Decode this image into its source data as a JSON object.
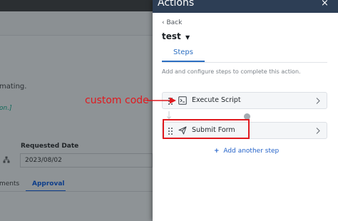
{
  "background": {
    "text_line": "mating.",
    "link_text": "on.]",
    "requested_date_label": "Requested Date",
    "requested_date_value": "2023/08/02",
    "tabs": [
      "ments",
      "Approval"
    ]
  },
  "drawer": {
    "title": "Actions",
    "close_icon": "×",
    "back_label": "Back",
    "item_title": "test",
    "tab_steps": "Steps",
    "description": "Add and configure steps to complete this action.",
    "steps": [
      {
        "label": "Execute Script",
        "icon": "terminal-icon"
      },
      {
        "label": "Submit Form",
        "icon": "send-icon"
      }
    ],
    "add_step_label": "Add another step"
  },
  "annotation": {
    "text": "custom code"
  },
  "colors": {
    "header": "#2d3e55",
    "accent": "#2d6fc2",
    "annotation_red": "#e0191e",
    "dim_overlay": "#8e9396"
  }
}
